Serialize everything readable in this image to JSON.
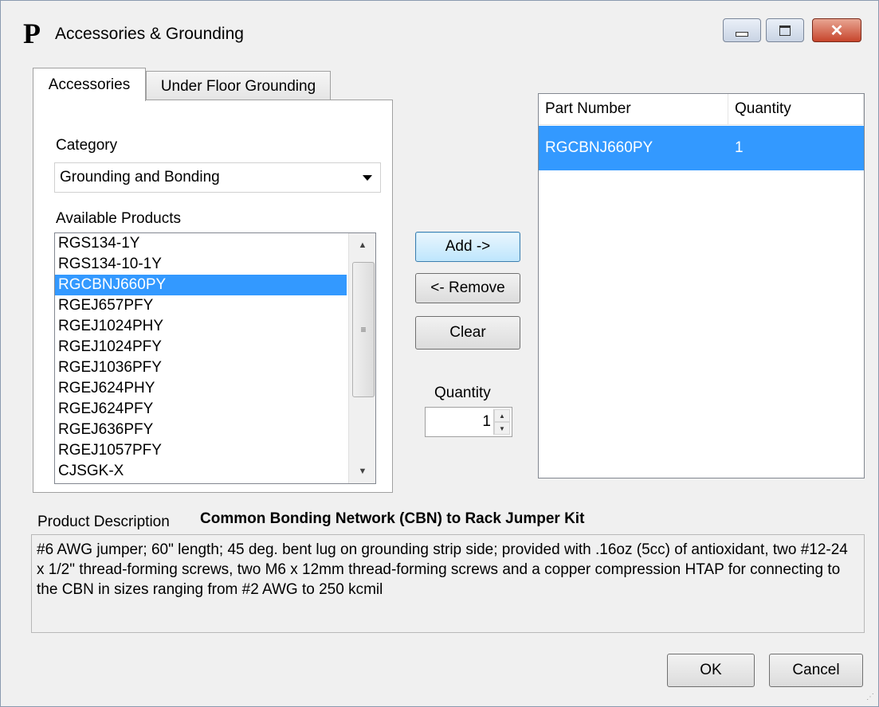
{
  "window": {
    "title": "Accessories & Grounding",
    "logo": "P",
    "controls": {
      "minimize": "minimize-icon",
      "maximize": "maximize-icon",
      "close": "close-icon"
    }
  },
  "tabs": [
    {
      "label": "Accessories",
      "active": true
    },
    {
      "label": "Under Floor Grounding",
      "active": false
    }
  ],
  "category": {
    "label": "Category",
    "selected": "Grounding and Bonding"
  },
  "available_products": {
    "label": "Available Products",
    "items": [
      "RGS134-1Y",
      "RGS134-10-1Y",
      "RGCBNJ660PY",
      "RGEJ657PFY",
      "RGEJ1024PHY",
      "RGEJ1024PFY",
      "RGEJ1036PFY",
      "RGEJ624PHY",
      "RGEJ624PFY",
      "RGEJ636PFY",
      "RGEJ1057PFY",
      "CJSGK-X"
    ],
    "selected": "RGCBNJ660PY"
  },
  "actions": {
    "add": "Add ->",
    "remove": "<- Remove",
    "clear": "Clear"
  },
  "quantity": {
    "label": "Quantity",
    "value": "1"
  },
  "selected_parts": {
    "columns": [
      "Part Number",
      "Quantity"
    ],
    "rows": [
      {
        "part_number": "RGCBNJ660PY",
        "quantity": "1"
      }
    ]
  },
  "product_description": {
    "label": "Product Description",
    "title": "Common Bonding Network (CBN) to Rack Jumper Kit",
    "text": "#6 AWG jumper; 60\" length; 45 deg. bent lug on grounding strip side; provided with .16oz (5cc) of antioxidant, two #12-24 x 1/2\" thread-forming screws, two M6 x 12mm thread-forming screws and a copper compression HTAP for connecting to the CBN in sizes ranging from #2 AWG to 250 kcmil"
  },
  "footer": {
    "ok": "OK",
    "cancel": "Cancel"
  },
  "colors": {
    "selection": "#3399ff",
    "window_bg": "#f0f0f0"
  }
}
